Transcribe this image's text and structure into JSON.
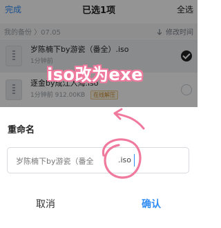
{
  "topbar": {
    "done": "完成",
    "title": "已选1项",
    "select_all": "全选"
  },
  "path": {
    "crumb": "我的备份 〉07.05",
    "sort_label": "修改时间"
  },
  "files": [
    {
      "name": "岁陈楠下by游瓷（番全）.iso",
      "meta": "1分钟前",
      "selected": true,
      "tag": ""
    },
    {
      "name": "逐金by成江入海.iso",
      "meta": "1分钟前  912.00KB",
      "selected": false,
      "tag": "在线解压"
    }
  ],
  "annotation": {
    "text": "iso改为exe",
    "color": "#f07a9d"
  },
  "dialog": {
    "title": "重命名",
    "input_value": "岁陈楠下by游瓷（番全",
    "extension": ".iso",
    "cancel": "取消",
    "confirm": "确认"
  },
  "colors": {
    "accent": "#2f8cf5",
    "annotation": "#f07a9d"
  },
  "icons": [
    "sort-icon",
    "zip-file-icon",
    "check-icon",
    "arrow-icon"
  ]
}
